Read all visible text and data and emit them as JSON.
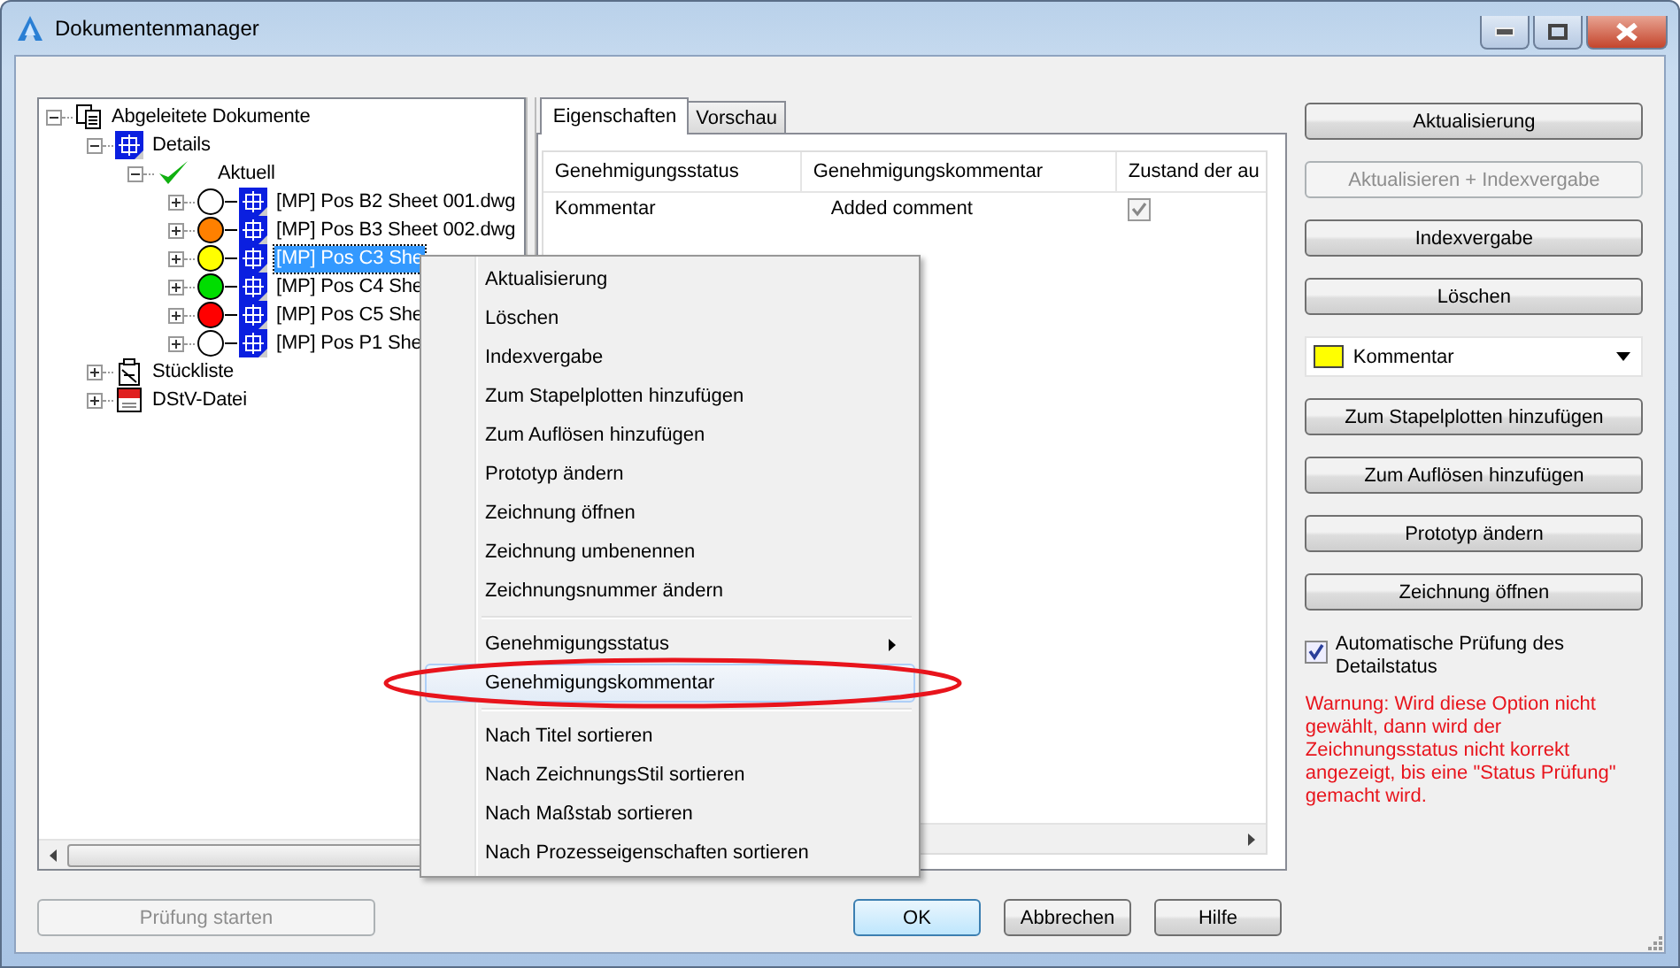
{
  "window": {
    "title": "Dokumentenmanager"
  },
  "tree": {
    "items": [
      {
        "label": "Abgeleitete Dokumente",
        "kind": "documents",
        "expanded": true,
        "selected": false,
        "children": [
          {
            "label": "Details",
            "kind": "detail",
            "expanded": true,
            "selected": false,
            "children": [
              {
                "label": "Aktuell",
                "kind": "check",
                "expanded": true,
                "selected": false,
                "children": [
                  {
                    "label": "[MP] Pos B2 Sheet 001.dwg",
                    "kind": "drawing",
                    "expanded": false,
                    "selected": false,
                    "color": "#ffffff"
                  },
                  {
                    "label": "[MP] Pos B3 Sheet 002.dwg",
                    "kind": "drawing",
                    "expanded": false,
                    "selected": false,
                    "color": "#ff8000"
                  },
                  {
                    "label": "[MP] Pos C3 She",
                    "kind": "drawing",
                    "expanded": false,
                    "selected": true,
                    "color": "#ffff00"
                  },
                  {
                    "label": "[MP] Pos C4 She",
                    "kind": "drawing",
                    "expanded": false,
                    "selected": false,
                    "color": "#00dd00"
                  },
                  {
                    "label": "[MP] Pos C5 She",
                    "kind": "drawing",
                    "expanded": false,
                    "selected": false,
                    "color": "#ff0000"
                  },
                  {
                    "label": "[MP] Pos P1 She",
                    "kind": "drawing",
                    "expanded": false,
                    "selected": false,
                    "color": "#ffffff"
                  }
                ]
              }
            ]
          },
          {
            "label": "Stückliste",
            "kind": "parts-list",
            "expanded": false,
            "selected": false
          },
          {
            "label": "DStV-Datei",
            "kind": "dstv",
            "expanded": false,
            "selected": false
          }
        ]
      }
    ]
  },
  "tabs": [
    {
      "label": "Eigenschaften",
      "selected": true
    },
    {
      "label": "Vorschau",
      "selected": false
    }
  ],
  "table": {
    "columns": [
      "Genehmigungsstatus",
      "Genehmigungskommentar",
      "Zustand der au"
    ],
    "rows": [
      {
        "status": "Kommentar",
        "comment": "Added comment",
        "checked": true
      }
    ]
  },
  "actions": [
    {
      "label": "Aktualisierung",
      "disabled": false
    },
    {
      "label": "Aktualisieren + Indexvergabe",
      "disabled": true
    },
    {
      "label": "Indexvergabe",
      "disabled": false
    },
    {
      "label": "Löschen",
      "disabled": false
    },
    {
      "kind": "dropdown",
      "label": "Kommentar",
      "color": "#ffff00"
    },
    {
      "label": "Zum Stapelplotten hinzufügen",
      "disabled": false
    },
    {
      "label": "Zum Auflösen hinzufügen",
      "disabled": false
    },
    {
      "label": "Prototyp ändern",
      "disabled": false
    },
    {
      "label": "Zeichnung öffnen",
      "disabled": false
    }
  ],
  "auto_check": {
    "label": "Automatische Prüfung des Detailstatus",
    "checked": true
  },
  "warning": "Warnung: Wird diese Option nicht gewählt, dann wird der Zeichnungsstatus nicht korrekt angezeigt, bis eine \"Status Prüfung\" gemacht wird.",
  "footer": {
    "check_button": {
      "label": "Prüfung starten",
      "disabled": true
    },
    "buttons": [
      {
        "label": "OK",
        "default": true
      },
      {
        "label": "Abbrechen",
        "default": false
      },
      {
        "label": "Hilfe",
        "default": false
      }
    ]
  },
  "context_menu": [
    {
      "kind": "item",
      "label": "Aktualisierung",
      "selected": false
    },
    {
      "kind": "item",
      "label": "Löschen",
      "selected": false
    },
    {
      "kind": "item",
      "label": "Indexvergabe",
      "selected": false
    },
    {
      "kind": "item",
      "label": "Zum Stapelplotten hinzufügen",
      "selected": false
    },
    {
      "kind": "item",
      "label": "Zum Auflösen hinzufügen",
      "selected": false
    },
    {
      "kind": "item",
      "label": "Prototyp ändern",
      "selected": false
    },
    {
      "kind": "item",
      "label": "Zeichnung öffnen",
      "selected": false
    },
    {
      "kind": "item",
      "label": "Zeichnung umbenennen",
      "selected": false
    },
    {
      "kind": "item",
      "label": "Zeichnungsnummer ändern",
      "selected": false
    },
    {
      "kind": "separator"
    },
    {
      "kind": "submenu",
      "label": "Genehmigungsstatus",
      "selected": false
    },
    {
      "kind": "item",
      "label": "Genehmigungskommentar",
      "selected": true
    },
    {
      "kind": "separator"
    },
    {
      "kind": "item",
      "label": "Nach Titel sortieren",
      "selected": false
    },
    {
      "kind": "item",
      "label": "Nach ZeichnungsStil sortieren",
      "selected": false
    },
    {
      "kind": "item",
      "label": "Nach Maßstab sortieren",
      "selected": false
    },
    {
      "kind": "item",
      "label": "Nach Prozesseigenschaften sortieren",
      "selected": false
    }
  ]
}
